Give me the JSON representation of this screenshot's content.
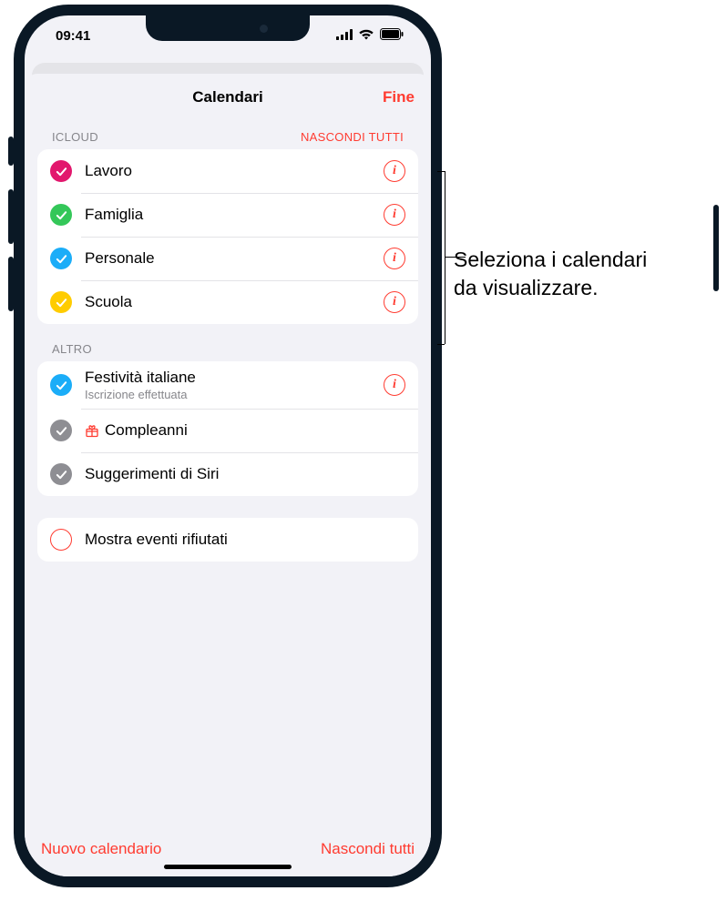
{
  "statusbar": {
    "time": "09:41"
  },
  "sheet": {
    "title": "Calendari",
    "done": "Fine"
  },
  "icloud": {
    "header": "ICLOUD",
    "hide": "NASCONDI TUTTI",
    "items": [
      {
        "label": "Lavoro",
        "color": "#e2176d"
      },
      {
        "label": "Famiglia",
        "color": "#34c759"
      },
      {
        "label": "Personale",
        "color": "#1badf8"
      },
      {
        "label": "Scuola",
        "color": "#ffcc00"
      }
    ]
  },
  "altro": {
    "header": "ALTRO",
    "items": [
      {
        "label": "Festività italiane",
        "sub": "Iscrizione effettuata",
        "color": "#1badf8",
        "info": true
      },
      {
        "label": "Compleanni",
        "color": "#8e8e93",
        "gift": true
      },
      {
        "label": "Suggerimenti di Siri",
        "color": "#8e8e93"
      }
    ]
  },
  "declined": {
    "label": "Mostra eventi rifiutati"
  },
  "bottom": {
    "new": "Nuovo calendario",
    "hideall": "Nascondi tutti"
  },
  "callout": {
    "line1": "Seleziona i calendari",
    "line2": "da visualizzare."
  }
}
